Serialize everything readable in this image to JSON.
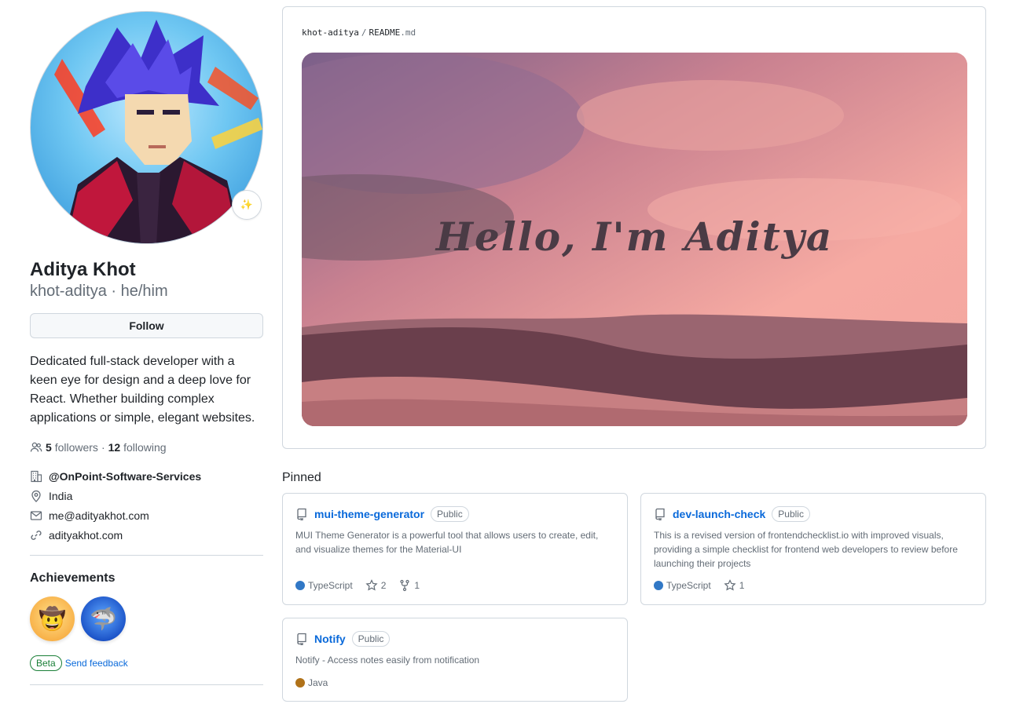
{
  "profile": {
    "name": "Aditya Khot",
    "login": "khot-aditya · he/him",
    "status_emoji": "✨",
    "follow_label": "Follow",
    "bio": "Dedicated full-stack developer with a keen eye for design and a deep love for React. Whether building complex applications or simple, elegant websites.",
    "followers_count": "5",
    "followers_label": "followers",
    "separator": "·",
    "following_count": "12",
    "following_label": "following",
    "organization": "@OnPoint-Software-Services",
    "location": "India",
    "email": "me@adityakhot.com",
    "website": "adityakhot.com"
  },
  "achievements": {
    "title": "Achievements",
    "badges": [
      {
        "name": "yolo",
        "emoji": "🤠"
      },
      {
        "name": "shark",
        "emoji": "🦈"
      }
    ],
    "beta_label": "Beta",
    "feedback_label": "Send feedback"
  },
  "readme": {
    "owner": "khot-aditya",
    "separator": "/",
    "file": "README",
    "ext": ".md",
    "banner_text": "Hello, I'm Aditya"
  },
  "pinned": {
    "title": "Pinned",
    "repos": [
      {
        "name": "mui-theme-generator",
        "visibility": "Public",
        "description": "MUI Theme Generator is a powerful tool that allows users to create, edit, and visualize themes for the Material-UI",
        "language": "TypeScript",
        "language_color": "#3178c6",
        "stars": "2",
        "forks": "1"
      },
      {
        "name": "dev-launch-check",
        "visibility": "Public",
        "description": "This is a revised version of frontendchecklist.io with improved visuals, providing a simple checklist for frontend web developers to review before launching their projects",
        "language": "TypeScript",
        "language_color": "#3178c6",
        "stars": "1"
      },
      {
        "name": "Notify",
        "visibility": "Public",
        "description": "Notify - Access notes easily from notification",
        "language": "Java",
        "language_color": "#b07219"
      }
    ]
  },
  "colors": {
    "link": "#0969da",
    "muted": "#636c76",
    "border": "#d0d7de",
    "beta_green": "#1a7f37"
  }
}
